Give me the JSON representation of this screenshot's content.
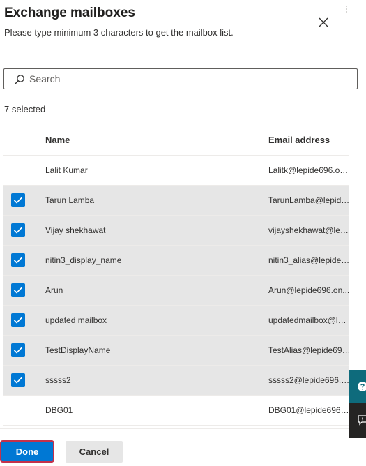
{
  "panel": {
    "title": "Exchange mailboxes",
    "subtitle": "Please type minimum 3 characters to get the mailbox list."
  },
  "search": {
    "placeholder": "Search",
    "value": ""
  },
  "selection": {
    "count_text": "7 selected"
  },
  "table": {
    "columns": {
      "name": "Name",
      "email": "Email address"
    },
    "rows": [
      {
        "name": "Lalit Kumar",
        "email": "Lalitk@lepide696.on...",
        "selected": false
      },
      {
        "name": "Tarun Lamba",
        "email": "TarunLamba@lepide...",
        "selected": true
      },
      {
        "name": "Vijay shekhawat",
        "email": "vijayshekhawat@lepi...",
        "selected": true
      },
      {
        "name": "nitin3_display_name",
        "email": "nitin3_alias@lepide6...",
        "selected": true
      },
      {
        "name": "Arun",
        "email": "Arun@lepide696.on...",
        "selected": true
      },
      {
        "name": "updated mailbox",
        "email": "updatedmailbox@lep...",
        "selected": true
      },
      {
        "name": "TestDisplayName",
        "email": "TestAlias@lepide696....",
        "selected": true
      },
      {
        "name": "sssss2",
        "email": "sssss2@lepide696.on...",
        "selected": true
      },
      {
        "name": "DBG01",
        "email": "DBG01@lepide696.o...",
        "selected": false
      }
    ]
  },
  "footer": {
    "done_label": "Done",
    "cancel_label": "Cancel"
  },
  "colors": {
    "accent": "#0078d4",
    "selected_row": "#e6e6e6",
    "focus_ring": "#c4314b",
    "side_tab_teal": "#0e6b7c",
    "side_tab_dark": "#252423"
  },
  "icons": {
    "close": "close-icon",
    "search": "search-icon",
    "checkbox": "checkmark-icon",
    "side_help": "help-icon",
    "side_feedback": "feedback-icon"
  }
}
